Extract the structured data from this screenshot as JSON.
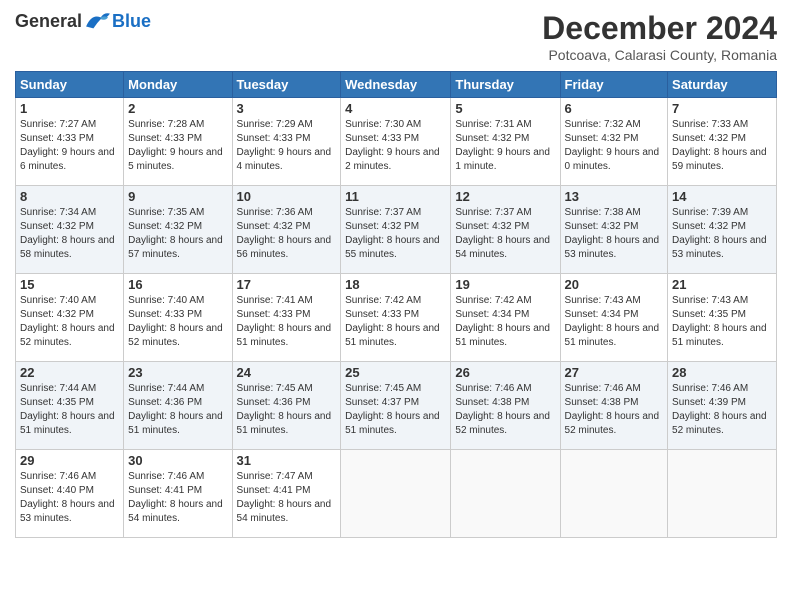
{
  "header": {
    "logo_general": "General",
    "logo_blue": "Blue",
    "month_title": "December 2024",
    "location": "Potcoava, Calarasi County, Romania"
  },
  "days_of_week": [
    "Sunday",
    "Monday",
    "Tuesday",
    "Wednesday",
    "Thursday",
    "Friday",
    "Saturday"
  ],
  "weeks": [
    [
      {
        "day": 1,
        "sunrise": "7:27 AM",
        "sunset": "4:33 PM",
        "daylight": "9 hours and 6 minutes."
      },
      {
        "day": 2,
        "sunrise": "7:28 AM",
        "sunset": "4:33 PM",
        "daylight": "9 hours and 5 minutes."
      },
      {
        "day": 3,
        "sunrise": "7:29 AM",
        "sunset": "4:33 PM",
        "daylight": "9 hours and 4 minutes."
      },
      {
        "day": 4,
        "sunrise": "7:30 AM",
        "sunset": "4:33 PM",
        "daylight": "9 hours and 2 minutes."
      },
      {
        "day": 5,
        "sunrise": "7:31 AM",
        "sunset": "4:32 PM",
        "daylight": "9 hours and 1 minute."
      },
      {
        "day": 6,
        "sunrise": "7:32 AM",
        "sunset": "4:32 PM",
        "daylight": "9 hours and 0 minutes."
      },
      {
        "day": 7,
        "sunrise": "7:33 AM",
        "sunset": "4:32 PM",
        "daylight": "8 hours and 59 minutes."
      }
    ],
    [
      {
        "day": 8,
        "sunrise": "7:34 AM",
        "sunset": "4:32 PM",
        "daylight": "8 hours and 58 minutes."
      },
      {
        "day": 9,
        "sunrise": "7:35 AM",
        "sunset": "4:32 PM",
        "daylight": "8 hours and 57 minutes."
      },
      {
        "day": 10,
        "sunrise": "7:36 AM",
        "sunset": "4:32 PM",
        "daylight": "8 hours and 56 minutes."
      },
      {
        "day": 11,
        "sunrise": "7:37 AM",
        "sunset": "4:32 PM",
        "daylight": "8 hours and 55 minutes."
      },
      {
        "day": 12,
        "sunrise": "7:37 AM",
        "sunset": "4:32 PM",
        "daylight": "8 hours and 54 minutes."
      },
      {
        "day": 13,
        "sunrise": "7:38 AM",
        "sunset": "4:32 PM",
        "daylight": "8 hours and 53 minutes."
      },
      {
        "day": 14,
        "sunrise": "7:39 AM",
        "sunset": "4:32 PM",
        "daylight": "8 hours and 53 minutes."
      }
    ],
    [
      {
        "day": 15,
        "sunrise": "7:40 AM",
        "sunset": "4:32 PM",
        "daylight": "8 hours and 52 minutes."
      },
      {
        "day": 16,
        "sunrise": "7:40 AM",
        "sunset": "4:33 PM",
        "daylight": "8 hours and 52 minutes."
      },
      {
        "day": 17,
        "sunrise": "7:41 AM",
        "sunset": "4:33 PM",
        "daylight": "8 hours and 51 minutes."
      },
      {
        "day": 18,
        "sunrise": "7:42 AM",
        "sunset": "4:33 PM",
        "daylight": "8 hours and 51 minutes."
      },
      {
        "day": 19,
        "sunrise": "7:42 AM",
        "sunset": "4:34 PM",
        "daylight": "8 hours and 51 minutes."
      },
      {
        "day": 20,
        "sunrise": "7:43 AM",
        "sunset": "4:34 PM",
        "daylight": "8 hours and 51 minutes."
      },
      {
        "day": 21,
        "sunrise": "7:43 AM",
        "sunset": "4:35 PM",
        "daylight": "8 hours and 51 minutes."
      }
    ],
    [
      {
        "day": 22,
        "sunrise": "7:44 AM",
        "sunset": "4:35 PM",
        "daylight": "8 hours and 51 minutes."
      },
      {
        "day": 23,
        "sunrise": "7:44 AM",
        "sunset": "4:36 PM",
        "daylight": "8 hours and 51 minutes."
      },
      {
        "day": 24,
        "sunrise": "7:45 AM",
        "sunset": "4:36 PM",
        "daylight": "8 hours and 51 minutes."
      },
      {
        "day": 25,
        "sunrise": "7:45 AM",
        "sunset": "4:37 PM",
        "daylight": "8 hours and 51 minutes."
      },
      {
        "day": 26,
        "sunrise": "7:46 AM",
        "sunset": "4:38 PM",
        "daylight": "8 hours and 52 minutes."
      },
      {
        "day": 27,
        "sunrise": "7:46 AM",
        "sunset": "4:38 PM",
        "daylight": "8 hours and 52 minutes."
      },
      {
        "day": 28,
        "sunrise": "7:46 AM",
        "sunset": "4:39 PM",
        "daylight": "8 hours and 52 minutes."
      }
    ],
    [
      {
        "day": 29,
        "sunrise": "7:46 AM",
        "sunset": "4:40 PM",
        "daylight": "8 hours and 53 minutes."
      },
      {
        "day": 30,
        "sunrise": "7:46 AM",
        "sunset": "4:41 PM",
        "daylight": "8 hours and 54 minutes."
      },
      {
        "day": 31,
        "sunrise": "7:47 AM",
        "sunset": "4:41 PM",
        "daylight": "8 hours and 54 minutes."
      },
      null,
      null,
      null,
      null
    ]
  ]
}
